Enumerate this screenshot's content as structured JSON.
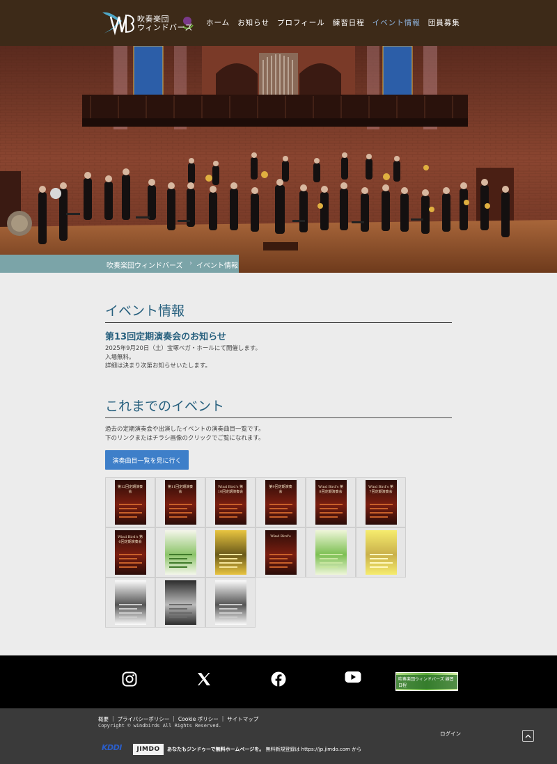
{
  "header": {
    "logo_text_line1": "吹奏楽団",
    "logo_text_line2": "ウィンドバーズ",
    "nav": [
      {
        "label": "ホーム"
      },
      {
        "label": "お知らせ"
      },
      {
        "label": "プロフィール"
      },
      {
        "label": "練習日程"
      },
      {
        "label": "イベント情報",
        "active": true
      },
      {
        "label": "団員募集"
      }
    ]
  },
  "breadcrumb": {
    "home": "吹奏楽団ウィンドバーズ",
    "separator": "›",
    "current": "イベント情報"
  },
  "section1": {
    "title": "イベント情報",
    "subtitle": "第13回定期演奏会のお知らせ",
    "lines": [
      "2025年9月20日（土）宝塚ベガ・ホールにて開催します。",
      "入場無料。",
      "詳細は決まり次第お知らせいたします。"
    ]
  },
  "section2": {
    "title": "これまでのイベント",
    "lines": [
      "過去の定期演奏会や出演したイベントの演奏曲目一覧です。",
      "下のリンクまたはチラシ画像のクリックでご覧になれます。"
    ],
    "button_label": "演奏曲目一覧を見に行く"
  },
  "flyers": [
    {
      "style": "red",
      "title": "第12回定期演奏会"
    },
    {
      "style": "red",
      "title": "第11回定期演奏会"
    },
    {
      "style": "red",
      "title": "Wind Bird's 第10回定期演奏会"
    },
    {
      "style": "red",
      "title": "第9回定期演奏会"
    },
    {
      "style": "red",
      "title": "Wind Bird's 第8回定期演奏会"
    },
    {
      "style": "red",
      "title": "Wind Bird's 第7回定期演奏会"
    },
    {
      "style": "red",
      "title": "Wind Bird's 第6回定期演奏会"
    },
    {
      "style": "green",
      "title": ""
    },
    {
      "style": "gold",
      "title": ""
    },
    {
      "style": "red",
      "title": "Wind Bird's"
    },
    {
      "style": "lightgreen",
      "title": ""
    },
    {
      "style": "yellow",
      "title": ""
    },
    {
      "style": "white",
      "title": ""
    },
    {
      "style": "gray",
      "title": ""
    },
    {
      "style": "white",
      "title": ""
    }
  ],
  "social": {
    "icons": [
      "instagram-icon",
      "x-icon",
      "facebook-icon",
      "youtube-icon"
    ],
    "banner_text": "吹奏楽団ウィンドバーズ 練習日程"
  },
  "footer": {
    "links": [
      "概要",
      "プライバシーポリシー",
      "Cookie ポリシー",
      "サイトマップ"
    ],
    "copyright": "Copyright © windbirds All Rights Reserved.",
    "login": "ログイン",
    "kddi": "KDDI",
    "jimdo": "JIMDO",
    "promo_bold": "あなたもジンドゥーで無料ホームページを。",
    "promo_rest": " 無料新規登録は https://jp.jimdo.com から"
  },
  "colors": {
    "header_bg": "#3d2a18",
    "accent": "#27607e",
    "nav_active": "#8fb5e0",
    "button": "#3e7fc9",
    "breadcrumb_bg": "#7ba4a8"
  }
}
